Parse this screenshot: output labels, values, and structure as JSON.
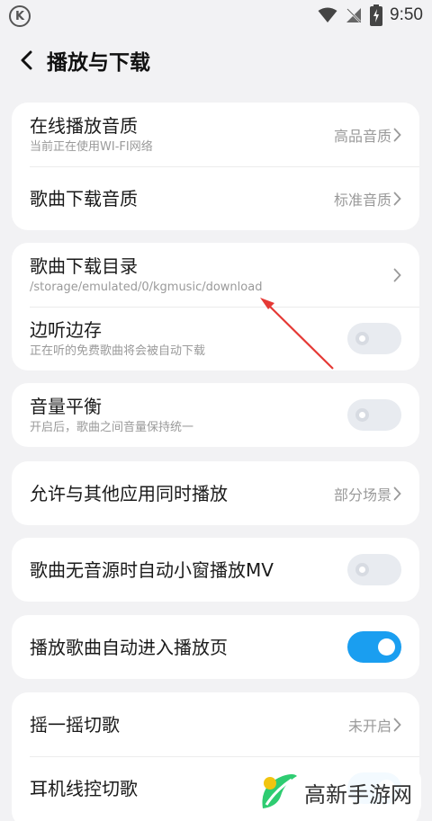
{
  "status_bar": {
    "time": "9:50",
    "app_badge": "K",
    "icons": [
      "wifi-icon",
      "signal-muted-icon",
      "battery-charging-icon"
    ]
  },
  "header": {
    "title": "播放与下载",
    "back_icon": "chevron-left-icon"
  },
  "groups": [
    {
      "rows": [
        {
          "title": "在线播放音质",
          "subtitle": "当前正在使用WI-FI网络",
          "value": "高品音质",
          "control": "chevron"
        },
        {
          "title": "歌曲下载音质",
          "value": "标准音质",
          "control": "chevron"
        }
      ]
    },
    {
      "rows": [
        {
          "title": "歌曲下载目录",
          "subtitle": "/storage/emulated/0/kgmusic/download",
          "control": "chevron"
        },
        {
          "title": "边听边存",
          "subtitle": "正在听的免费歌曲将会被自动下载",
          "control": "toggle",
          "on": false
        }
      ]
    },
    {
      "rows": [
        {
          "title": "音量平衡",
          "subtitle": "开启后，歌曲之间音量保持统一",
          "control": "toggle",
          "on": false
        }
      ]
    },
    {
      "rows": [
        {
          "title": "允许与其他应用同时播放",
          "value": "部分场景",
          "control": "chevron"
        }
      ]
    },
    {
      "rows": [
        {
          "title": "歌曲无音源时自动小窗播放MV",
          "control": "toggle",
          "on": false
        }
      ]
    },
    {
      "rows": [
        {
          "title": "播放歌曲自动进入播放页",
          "control": "toggle",
          "on": true
        }
      ]
    },
    {
      "rows": [
        {
          "title": "摇一摇切歌",
          "value": "未开启",
          "control": "chevron"
        },
        {
          "title": "耳机线控切歌",
          "control": "toggle",
          "on": true
        }
      ]
    }
  ],
  "annotation": {
    "color": "#e53935"
  },
  "watermark": {
    "text": "高新手游网",
    "icon": "leaf-logo-icon",
    "colors": [
      "#2ecc71",
      "#f1c40f"
    ]
  },
  "colors": {
    "accent": "#1a9ef0",
    "background": "#f2f2f4",
    "card": "#ffffff"
  }
}
